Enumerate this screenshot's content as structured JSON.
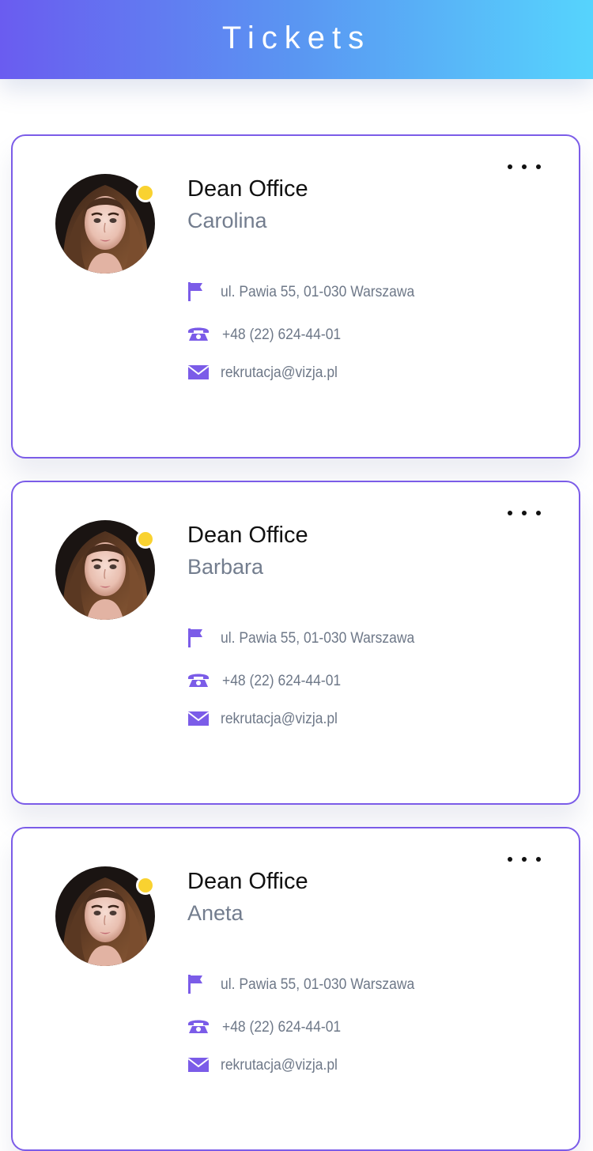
{
  "header": {
    "title": "Tickets"
  },
  "colors": {
    "accent": "#7b5ce8",
    "status_online": "#f9d230",
    "gradient_start": "#6a5cf0",
    "gradient_end": "#56d4fd"
  },
  "icons": {
    "more": "more-dots-icon",
    "address": "flag-icon",
    "phone": "phone-icon",
    "email": "mail-icon"
  },
  "cards": [
    {
      "title": "Dean Office",
      "name": "Carolina",
      "address": "ul. Pawia 55, 01-030 Warszawa",
      "phone": "+48 (22) 624-44-01",
      "email": "rekrutacja@vizja.pl"
    },
    {
      "title": "Dean Office",
      "name": "Barbara",
      "address": "ul. Pawia 55, 01-030 Warszawa",
      "phone": "+48 (22) 624-44-01",
      "email": "rekrutacja@vizja.pl"
    },
    {
      "title": "Dean Office",
      "name": "Aneta",
      "address": "ul. Pawia 55, 01-030 Warszawa",
      "phone": "+48 (22) 624-44-01",
      "email": "rekrutacja@vizja.pl"
    }
  ]
}
